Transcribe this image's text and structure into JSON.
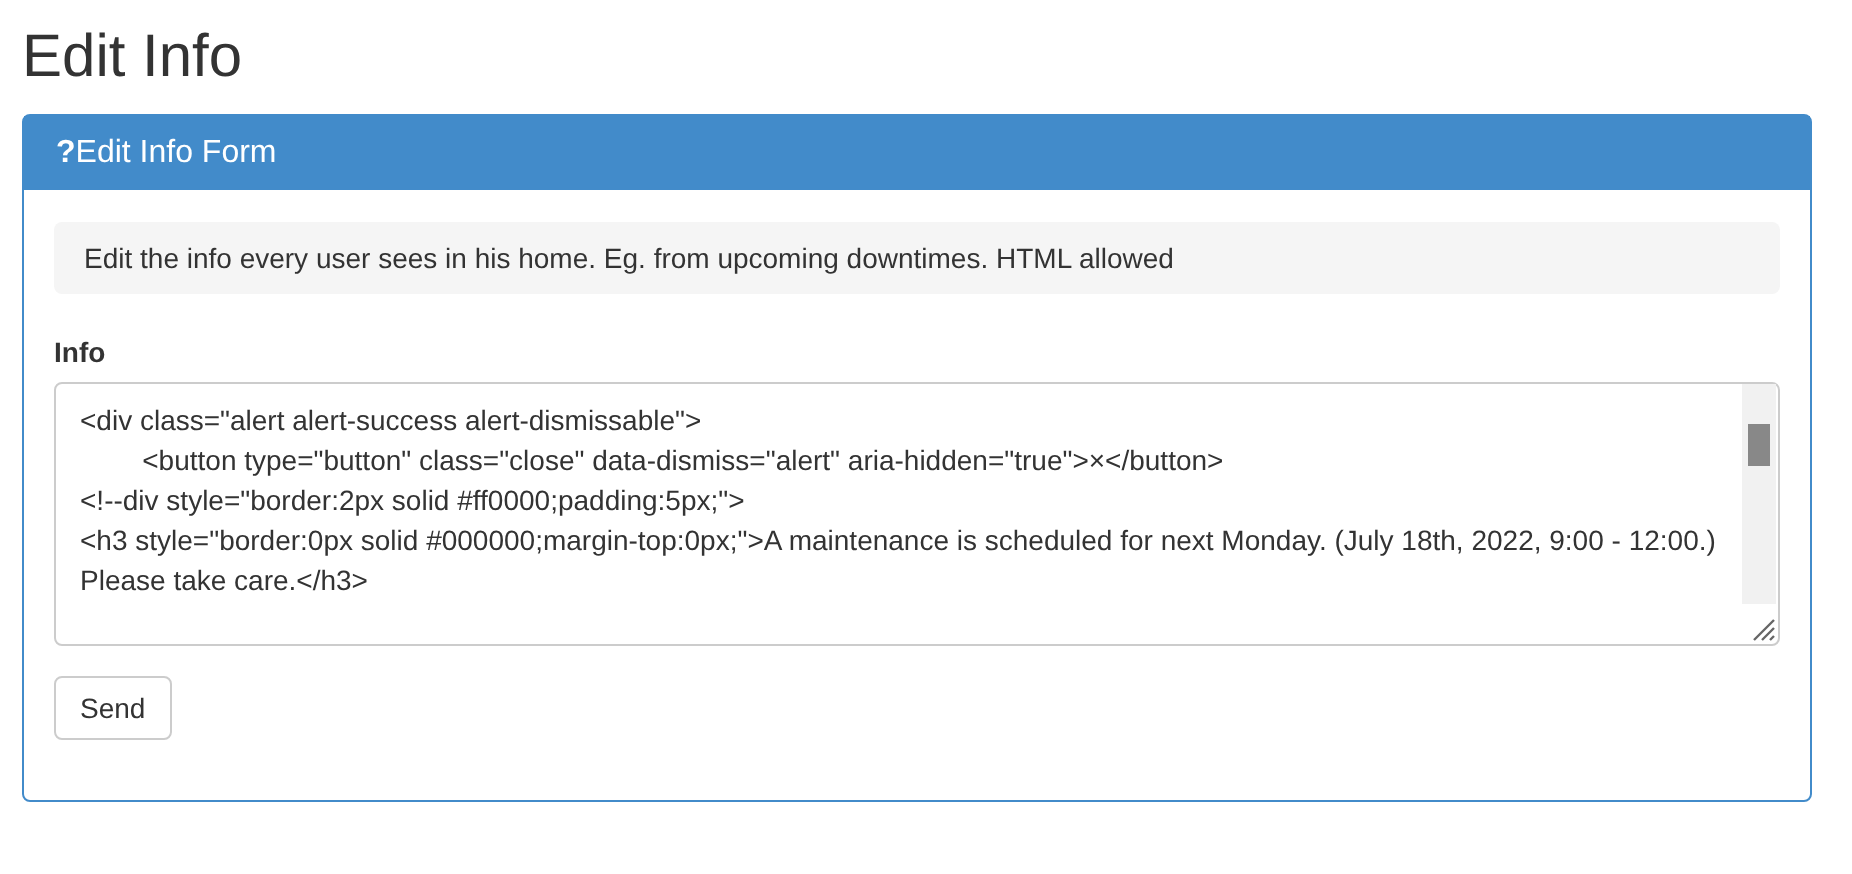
{
  "page_title": "Edit Info",
  "panel": {
    "icon_text": "?",
    "title": "Edit Info Form",
    "help_text": "Edit the info every user sees in his home. Eg. from upcoming downtimes. HTML allowed",
    "field": {
      "label": "Info",
      "value": "<div class=\"alert alert-success alert-dismissable\">\n\t\t<button type=\"button\" class=\"close\" data-dismiss=\"alert\" aria-hidden=\"true\">×</button>\n<!--div style=\"border:2px solid #ff0000;padding:5px;\">\n<h3 style=\"border:0px solid #000000;margin-top:0px;\">A maintenance is scheduled for next Monday. (July 18th, 2022, 9:00 - 12:00.) Please take care.</h3>"
    },
    "button": "Send"
  }
}
